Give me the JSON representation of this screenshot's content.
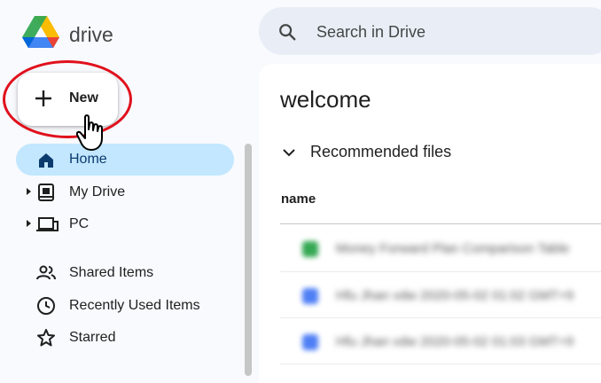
{
  "app": {
    "brand": "drive",
    "logo_icon": "google-drive-logo"
  },
  "search": {
    "placeholder": "Search in Drive",
    "icon": "search-icon"
  },
  "new_button": {
    "label": "New",
    "icon": "plus-icon",
    "annotation_color": "#e0101c"
  },
  "sidebar": {
    "items": [
      {
        "label": "Home",
        "icon": "home-icon",
        "active": true
      },
      {
        "label": "My Drive",
        "icon": "my-drive-icon",
        "expandable": true
      },
      {
        "label": "PC",
        "icon": "computer-icon",
        "expandable": true
      },
      {
        "label": "Shared Items",
        "icon": "shared-people-icon"
      },
      {
        "label": "Recently Used Items",
        "icon": "clock-icon"
      },
      {
        "label": "Starred",
        "icon": "star-icon"
      }
    ]
  },
  "main": {
    "title": "welcome",
    "section": "Recommended files",
    "columns": [
      "name"
    ],
    "files": [
      {
        "name": "Money Forward Plan Comparison Table",
        "color": "#34a853"
      },
      {
        "name": "Hfu Jhan vdw 2020-05-02 01:02 GMT+9",
        "color": "#4f7ff5"
      },
      {
        "name": "Hfu Jhan vdw 2020-05-02 01:03 GMT+9",
        "color": "#4f7ff5"
      }
    ]
  },
  "colors": {
    "accent": "#c2e7ff",
    "background": "#f8fafd",
    "search_bg": "#e9eef6"
  }
}
